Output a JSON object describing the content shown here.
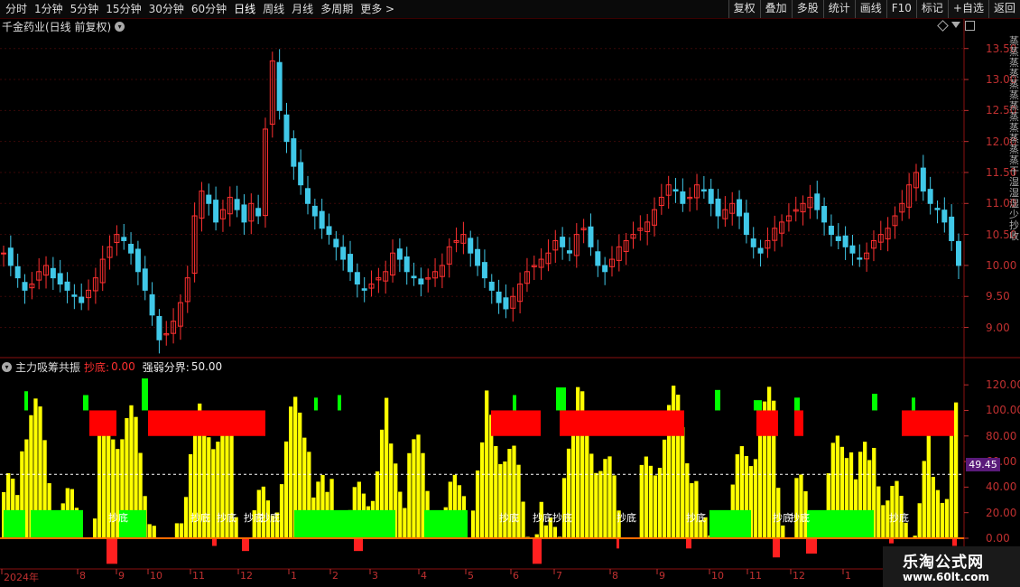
{
  "toolbar": {
    "periods": [
      "分时",
      "1分钟",
      "5分钟",
      "15分钟",
      "30分钟",
      "60分钟",
      "日线",
      "周线",
      "月线",
      "多周期",
      "更多 >"
    ],
    "active_period": "日线",
    "buttons": [
      "复权",
      "叠加",
      "多股",
      "统计",
      "画线",
      "F10",
      "标记",
      "+自选",
      "返回"
    ]
  },
  "chart_title": "千金药业(日线 前复权)",
  "indicator": {
    "name": "主力吸筹共振",
    "param1_label": "抄底:",
    "param1_value": "0.00",
    "param2_label": "强弱分界:",
    "param2_value": "50.00",
    "current_value": "49.45"
  },
  "price_axis": [
    "13.50",
    "13.00",
    "12.50",
    "12.00",
    "11.50",
    "11.00",
    "10.50",
    "10.00",
    "9.50",
    "9.00"
  ],
  "indicator_axis": [
    "120.00",
    "100.00",
    "80.00",
    "60.00",
    "40.00",
    "20.00",
    "0.00"
  ],
  "date_axis": [
    "2024年",
    "8",
    "9",
    "10",
    "11",
    "12",
    "1",
    "2",
    "3",
    "4",
    "5",
    "6",
    "7",
    "8",
    "9",
    "10",
    "11",
    "12",
    "1"
  ],
  "signal_labels": [
    "抄底",
    "抄底",
    "抄底",
    "抄底",
    "抄底",
    "抄底",
    "抄底",
    "抄底",
    "抄底",
    "抄底",
    "抄底",
    "抄底",
    "抄底"
  ],
  "right_column_text": "蒸蒸蒸蒸蒸蒸蒸蒸蒸蒸蒸蒸干湿湿湿少抄收",
  "watermark": {
    "line1": "乐淘公式网",
    "line2": "www.60lt.com"
  },
  "colors": {
    "up": "#ff3030",
    "down": "#40c8e8",
    "yellow": "#ffff00",
    "green": "#00ff00",
    "red_block": "#ff0000"
  },
  "chart_data": {
    "type": "candlestick+indicator",
    "price_range": [
      8.6,
      13.7
    ],
    "closes": [
      10.2,
      10.0,
      9.8,
      9.6,
      9.7,
      9.9,
      10.0,
      9.8,
      9.7,
      9.6,
      9.5,
      9.4,
      9.6,
      9.8,
      10.1,
      10.3,
      10.5,
      10.4,
      10.2,
      9.9,
      9.6,
      9.2,
      8.8,
      8.9,
      9.1,
      9.4,
      9.8,
      10.8,
      11.2,
      11.0,
      10.7,
      10.9,
      11.1,
      10.9,
      10.7,
      11.0,
      10.8,
      12.2,
      13.3,
      12.5,
      12.0,
      11.6,
      11.3,
      11.0,
      10.8,
      10.6,
      10.5,
      10.3,
      10.1,
      9.9,
      9.7,
      9.6,
      9.7,
      9.8,
      9.9,
      10.2,
      10.1,
      9.9,
      9.8,
      9.7,
      9.8,
      9.9,
      10.0,
      10.3,
      10.4,
      10.5,
      10.2,
      10.0,
      9.8,
      9.6,
      9.4,
      9.3,
      9.5,
      9.7,
      9.9,
      10.0,
      10.1,
      10.2,
      10.4,
      10.3,
      10.2,
      10.5,
      10.6,
      10.3,
      10.0,
      9.9,
      10.1,
      10.3,
      10.4,
      10.5,
      10.6,
      10.7,
      10.9,
      11.1,
      11.3,
      11.2,
      11.0,
      11.1,
      11.3,
      11.2,
      11.0,
      10.8,
      10.9,
      11.0,
      10.8,
      10.5,
      10.3,
      10.2,
      10.4,
      10.6,
      10.7,
      10.8,
      10.9,
      11.0,
      11.1,
      10.9,
      10.7,
      10.5,
      10.4,
      10.3,
      10.2,
      10.1,
      10.2,
      10.4,
      10.5,
      10.6,
      10.8,
      11.0,
      11.3,
      11.5,
      11.2,
      11.0,
      10.9,
      10.7,
      10.4,
      10.0
    ],
    "indicator_series": [
      "yellow area",
      "green bars",
      "red blocks",
      "green tops"
    ],
    "boundary_line": 50
  }
}
